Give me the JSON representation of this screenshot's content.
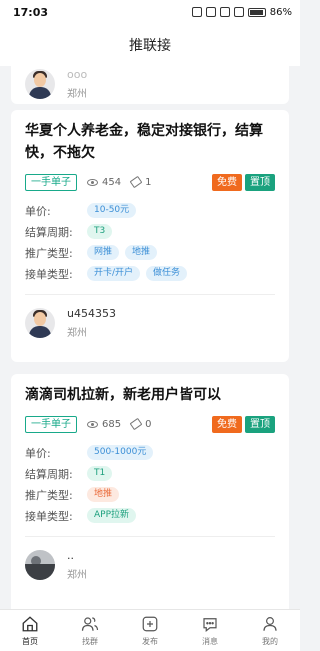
{
  "status": {
    "time": "17:03",
    "battery": "86%"
  },
  "header": {
    "title": "推联接"
  },
  "card0": {
    "user_name": "ooo",
    "user_city": "郑州"
  },
  "cards": [
    {
      "title_line1": "华夏个人养老金，稳定对接银行，结算",
      "title_line2": "快，不拖欠",
      "source_tag": "一手单子",
      "views": "454",
      "tags_count": "1",
      "badge_free": "免费",
      "badge_top": "置顶",
      "labels": {
        "price": "单价:",
        "cycle": "结算周期:",
        "promo": "推广类型:",
        "order": "接单类型:"
      },
      "price": "10-50元",
      "cycle": "T3",
      "promo": [
        "网推",
        "地推"
      ],
      "order": [
        "开卡/开户",
        "做任务"
      ],
      "user_name": "u454353",
      "user_city": "郑州"
    },
    {
      "title_line1": "滴滴司机拉新，新老用户皆可以",
      "source_tag": "一手单子",
      "views": "685",
      "tags_count": "0",
      "badge_free": "免费",
      "badge_top": "置顶",
      "labels": {
        "price": "单价:",
        "cycle": "结算周期:",
        "promo": "推广类型:",
        "order": "接单类型:"
      },
      "price": "500-1000元",
      "cycle": "T1",
      "promo": [
        "地推"
      ],
      "order": [
        "APP拉新"
      ],
      "user_name": "..",
      "user_city": "郑州"
    }
  ],
  "tabs": [
    {
      "label": "首页",
      "icon": "home-icon"
    },
    {
      "label": "找群",
      "icon": "group-icon"
    },
    {
      "label": "发布",
      "icon": "publish-icon"
    },
    {
      "label": "消息",
      "icon": "message-icon"
    },
    {
      "label": "我的",
      "icon": "profile-icon"
    }
  ],
  "colors": {
    "accent": "#18a98a",
    "free": "#f06a1e",
    "top": "#1aa27e"
  }
}
